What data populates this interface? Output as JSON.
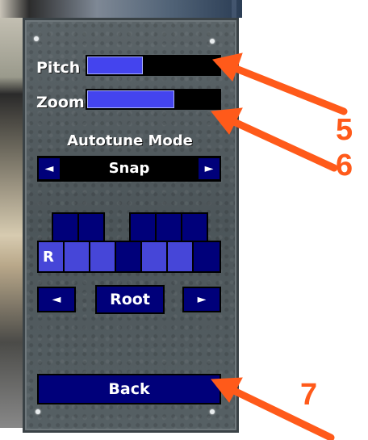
{
  "panel": {
    "pitch_label": "Pitch",
    "pitch_level": 0.42,
    "zoom_label": "Zoom",
    "zoom_level": 0.66,
    "autotune_title": "Autotune Mode",
    "mode_value": "Snap",
    "mode_prev_icon": "◄",
    "mode_next_icon": "►",
    "keyboard": {
      "root_key_label": "R"
    },
    "root_label": "Root",
    "root_prev_icon": "◄",
    "root_next_icon": "►",
    "back_label": "Back"
  },
  "callouts": {
    "five": "5",
    "six": "6",
    "seven": "7"
  },
  "colors": {
    "accent": "#00007a",
    "fill": "#4444ee",
    "key_light": "#4646d8",
    "callout": "#ff5a1a"
  }
}
